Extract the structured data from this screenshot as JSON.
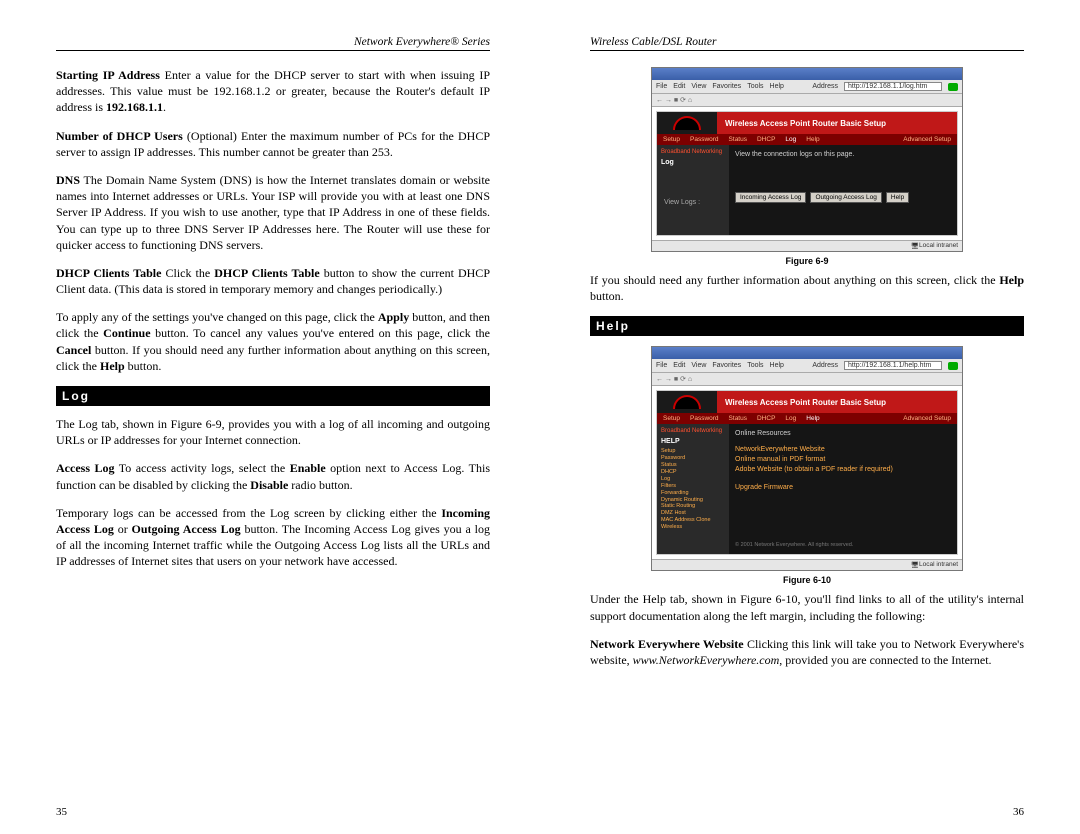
{
  "left": {
    "running_head": "Network Everywhere® Series",
    "para1_lead": "Starting IP Address",
    "para1_rest": "  Enter a value for the DHCP server to start with when issuing IP addresses.  This value must be 192.168.1.2 or greater, because the Router's default IP address is ",
    "para1_ip": "192.168.1.1",
    "para1_end": ".",
    "para2_lead": "Number of DHCP Users",
    "para2_rest": "  (Optional) Enter the maximum number of PCs for the DHCP server to assign IP addresses.  This number cannot be greater than 253.",
    "para3_lead": "DNS",
    "para3_rest": "  The Domain Name System (DNS) is how the Internet translates domain or website names into Internet addresses or URLs. Your ISP will provide you with at least one DNS Server IP Address. If you wish to use another, type that IP Address in one of these fields. You can type up to three DNS Server IP Addresses here. The Router will use these for quicker access to functioning DNS servers.",
    "para4_lead": "DHCP Clients Table",
    "para4_rest_a": "  Click the ",
    "para4_bold": "DHCP Clients Table",
    "para4_rest_b": " button to show the current DHCP Client data. (This data is stored in temporary memory and changes periodically.)",
    "para5_a": "To apply any of the settings you've changed on this page, click the ",
    "para5_apply": "Apply",
    "para5_b": " button, and then click the ",
    "para5_continue": "Continue",
    "para5_c": " button.  To cancel any values you've entered on this page, click the ",
    "para5_cancel": "Cancel",
    "para5_d": " button. If you should need any further information about anything on this screen, click the ",
    "para5_help": "Help",
    "para5_e": " button.",
    "sec_log": "Log",
    "para6": "The Log tab, shown in Figure 6-9, provides you with a log of all incoming and outgoing URLs or IP addresses for your Internet connection.",
    "para7_lead": "Access Log",
    "para7_a": "  To access activity logs, select the ",
    "para7_enable": "Enable",
    "para7_b": " option next to Access Log. This function can be disabled by clicking the ",
    "para7_disable": "Disable",
    "para7_c": " radio button.",
    "para8_a": "Temporary logs can be accessed from the Log screen by clicking either the ",
    "para8_in": "Incoming Access Log",
    "para8_or": " or ",
    "para8_out": "Outgoing Access Log",
    "para8_b": " button. The Incoming Access Log gives you a log of all the incoming Internet traffic while the Outgoing Access Log lists all the URLs and IP addresses of Internet sites that users on your network have accessed.",
    "pagenum": "35"
  },
  "right": {
    "running_head": "Wireless Cable/DSL Router",
    "fig1": {
      "menus": [
        "File",
        "Edit",
        "View",
        "Favorites",
        "Tools",
        "Help"
      ],
      "addr_label": "Address",
      "addr": "http://192.168.1.1/log.htm",
      "toolbar_hint": "← → ■ ⟳ ⌂",
      "title": "Wireless Access Point Router Basic Setup",
      "tabs": [
        "Setup",
        "Password",
        "Status",
        "DHCP",
        "Log",
        "Help"
      ],
      "adv": "Advanced Setup",
      "side_cat": "Broadband Networking",
      "side_item": "Log",
      "desc": "View the connection logs on this page.",
      "btn_label": "View Logs :",
      "btn_in": "Incoming Access Log",
      "btn_out": "Outgoing Access Log",
      "btn_help": "Help",
      "status": "Local intranet",
      "caption": "Figure 6-9"
    },
    "para1_a": "If you should need any further information about anything on this screen, click the ",
    "para1_b": "Help",
    "para1_c": " button.",
    "sec_help": "Help",
    "fig2": {
      "menus": [
        "File",
        "Edit",
        "View",
        "Favorites",
        "Tools",
        "Help"
      ],
      "addr_label": "Address",
      "addr": "http://192.168.1.1/help.htm",
      "toolbar_hint": "← → ■ ⟳ ⌂",
      "title": "Wireless Access Point Router Basic Setup",
      "tabs": [
        "Setup",
        "Password",
        "Status",
        "DHCP",
        "Log",
        "Help"
      ],
      "adv": "Advanced Setup",
      "side_cat": "Broadband Networking",
      "side_item": "HELP",
      "side_desc": "Online Resources",
      "side_links": [
        "Setup",
        "Password",
        "Status",
        "DHCP",
        "Log",
        "Filters",
        "Forwarding",
        "Dynamic Routing",
        "Static Routing",
        "DMZ Host",
        "MAC Address Clone",
        "Wireless"
      ],
      "res1": "NetworkEverywhere Website",
      "res2": "Online manual in PDF format",
      "res3": "Adobe Website (to obtain a PDF reader if required)",
      "res4": "Upgrade Firmware",
      "copyright": "© 2001 Network Everywhere. All rights reserved.",
      "status": "Local intranet",
      "caption": "Figure 6-10"
    },
    "para2": "Under the Help tab, shown in Figure 6-10, you'll find links to all of the utility's internal support documentation along the left margin, including the following:",
    "para3_lead": "Network Everywhere Website",
    "para3_a": "  Clicking this link will take you to Network Everywhere's website, ",
    "para3_url": "www.NetworkEverywhere.com",
    "para3_b": ", provided you are connected to the Internet.",
    "pagenum": "36"
  }
}
